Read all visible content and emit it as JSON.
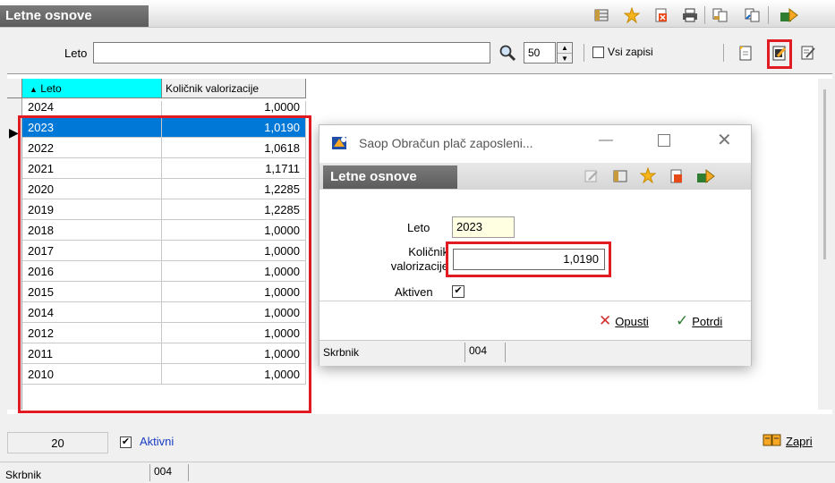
{
  "window": {
    "title": "Letne osnove"
  },
  "filter": {
    "leto_label": "Leto",
    "leto_value": "",
    "count": "50",
    "vsi_label": "Vsi zapisi"
  },
  "columns": {
    "leto": "Leto",
    "kolicnik": "Količnik valorizacije"
  },
  "rows": [
    {
      "leto": "2024",
      "kolicnik": "1,0000"
    },
    {
      "leto": "2023",
      "kolicnik": "1,0190"
    },
    {
      "leto": "2022",
      "kolicnik": "1,0618"
    },
    {
      "leto": "2021",
      "kolicnik": "1,1711"
    },
    {
      "leto": "2020",
      "kolicnik": "1,2285"
    },
    {
      "leto": "2019",
      "kolicnik": "1,2285"
    },
    {
      "leto": "2018",
      "kolicnik": "1,0000"
    },
    {
      "leto": "2017",
      "kolicnik": "1,0000"
    },
    {
      "leto": "2016",
      "kolicnik": "1,0000"
    },
    {
      "leto": "2015",
      "kolicnik": "1,0000"
    },
    {
      "leto": "2014",
      "kolicnik": "1,0000"
    },
    {
      "leto": "2012",
      "kolicnik": "1,0000"
    },
    {
      "leto": "2011",
      "kolicnik": "1,0000"
    },
    {
      "leto": "2010",
      "kolicnik": "1,0000"
    }
  ],
  "footer": {
    "count": "20",
    "aktivni_label": "Aktivni",
    "zapri_label": "Zapri"
  },
  "status": {
    "label": "Skrbnik",
    "value": "004"
  },
  "dialog": {
    "window_title": "Saop Obračun plač zaposleni...",
    "section_title": "Letne osnove",
    "leto_label": "Leto",
    "leto_value": "2023",
    "kolicnik_label_1": "Količnik",
    "kolicnik_label_2": "valorizacije",
    "kolicnik_value": "1,0190",
    "aktiven_label": "Aktiven",
    "opusti_label": "Opusti",
    "potrdi_label": "Potrdi",
    "status_label": "Skrbnik",
    "status_value": "004"
  },
  "colors": {
    "selection": "#0078d7",
    "highlight": "#e21b22",
    "header_cyan": "#00ffff"
  }
}
